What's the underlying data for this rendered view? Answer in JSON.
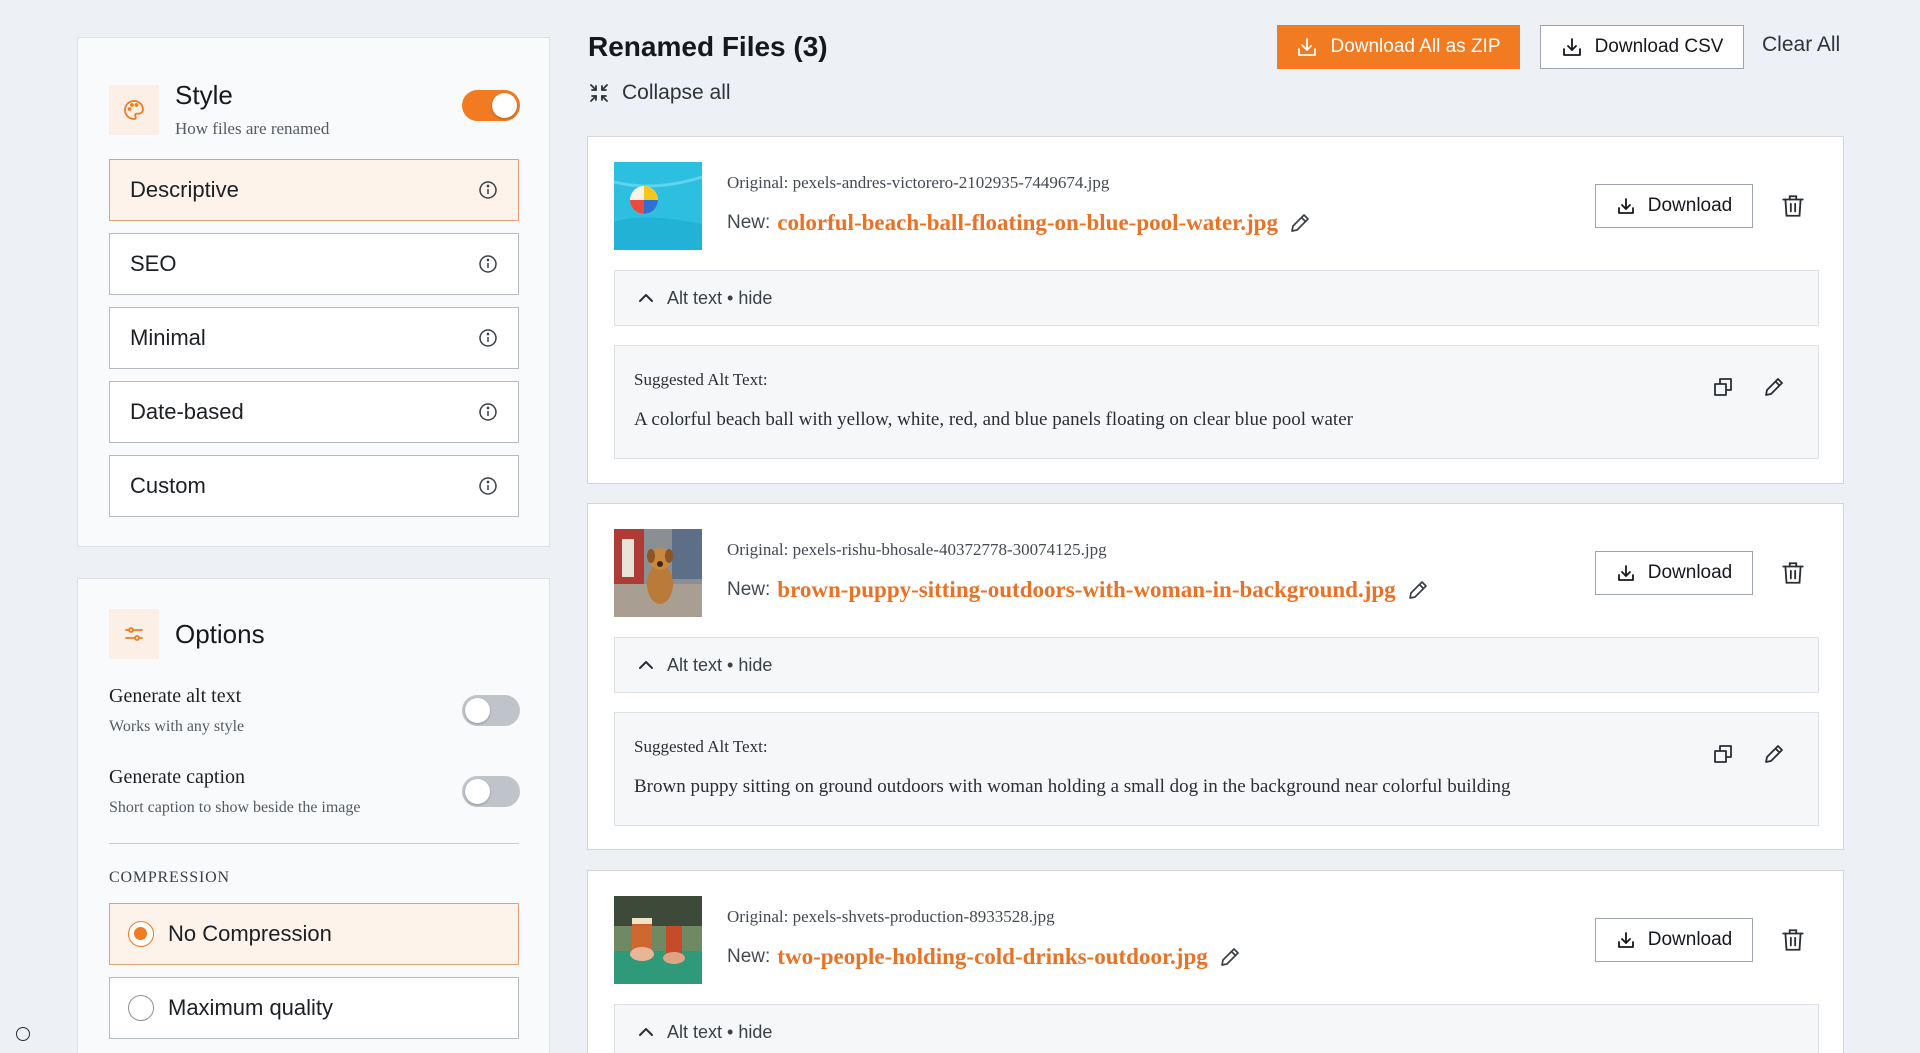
{
  "style_panel": {
    "title": "Style",
    "subtitle": "How files are renamed",
    "enabled": true,
    "options": [
      {
        "label": "Descriptive",
        "active": true
      },
      {
        "label": "SEO",
        "active": false
      },
      {
        "label": "Minimal",
        "active": false
      },
      {
        "label": "Date-based",
        "active": false
      },
      {
        "label": "Custom",
        "active": false
      }
    ]
  },
  "options_panel": {
    "title": "Options",
    "alt_text": {
      "label": "Generate alt text",
      "sub": "Works with any style",
      "enabled": false
    },
    "caption": {
      "label": "Generate caption",
      "sub": "Short caption to show beside the image",
      "enabled": false
    },
    "compression_label": "COMPRESSION",
    "compression_options": [
      {
        "label": "No Compression",
        "checked": true
      },
      {
        "label": "Maximum quality",
        "checked": false
      }
    ]
  },
  "header": {
    "title": "Renamed Files (3)",
    "collapse_label": "Collapse all",
    "zip_label": "Download All as ZIP",
    "csv_label": "Download CSV",
    "clear_label": "Clear All"
  },
  "card_labels": {
    "new_prefix": "New:",
    "download": "Download",
    "alt_toggle": "Alt text • hide",
    "suggested": "Suggested Alt Text:"
  },
  "files": [
    {
      "original": "Original: pexels-andres-victorero-2102935-7449674.jpg",
      "new_name": "colorful-beach-ball-floating-on-blue-pool-water.jpg",
      "alt": "A colorful beach ball with yellow, white, red, and blue panels floating on clear blue pool water"
    },
    {
      "original": "Original: pexels-rishu-bhosale-40372778-30074125.jpg",
      "new_name": "brown-puppy-sitting-outdoors-with-woman-in-background.jpg",
      "alt": "Brown puppy sitting on ground outdoors with woman holding a small dog in the background near colorful building"
    },
    {
      "original": "Original: pexels-shvets-production-8933528.jpg",
      "new_name": "two-people-holding-cold-drinks-outdoor.jpg",
      "alt": ""
    }
  ],
  "colors": {
    "accent": "#f27a20",
    "accent_text": "#eb7124",
    "background": "#edf0f4"
  }
}
